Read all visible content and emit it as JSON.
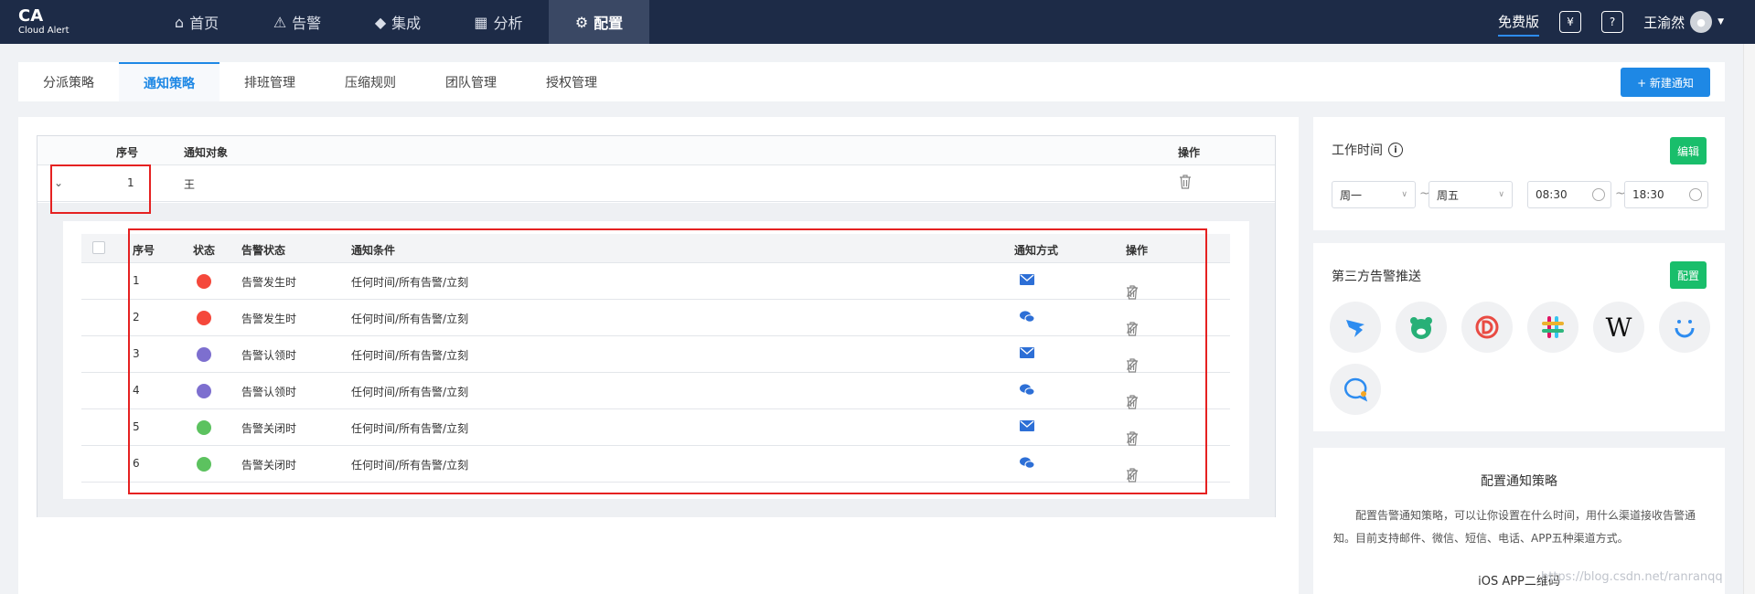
{
  "brand": {
    "name": "CA",
    "sub": "Cloud Alert"
  },
  "nav": [
    {
      "icon": "home-icon",
      "label": "首页",
      "active": false
    },
    {
      "icon": "alarm-icon",
      "label": "告警",
      "active": false
    },
    {
      "icon": "layers-icon",
      "label": "集成",
      "active": false
    },
    {
      "icon": "chart-icon",
      "label": "分析",
      "active": false
    },
    {
      "icon": "gear-icon",
      "label": "配置",
      "active": true
    }
  ],
  "header_right": {
    "plan": "免费版",
    "yen": "¥",
    "help": "?",
    "user": "王渝然"
  },
  "tabs": [
    "分派策略",
    "通知策略",
    "排班管理",
    "压缩规则",
    "团队管理",
    "授权管理"
  ],
  "active_tab": 1,
  "new_button": "+ 新建通知",
  "outer_table": {
    "headers": {
      "index": "序号",
      "target": "通知对象",
      "ops": "操作"
    },
    "row": {
      "index": "1",
      "target": "王"
    }
  },
  "inner_table": {
    "headers": {
      "index": "序号",
      "status": "状态",
      "alert_status": "告警状态",
      "condition": "通知条件",
      "via": "通知方式",
      "ops": "操作"
    },
    "rows": [
      {
        "index": "1",
        "color": "#f5483b",
        "alert_status": "告警发生时",
        "condition": "任何时间/所有告警/立刻",
        "via": "mail"
      },
      {
        "index": "2",
        "color": "#f5483b",
        "alert_status": "告警发生时",
        "condition": "任何时间/所有告警/立刻",
        "via": "wechat"
      },
      {
        "index": "3",
        "color": "#7d6fcf",
        "alert_status": "告警认领时",
        "condition": "任何时间/所有告警/立刻",
        "via": "mail"
      },
      {
        "index": "4",
        "color": "#7d6fcf",
        "alert_status": "告警认领时",
        "condition": "任何时间/所有告警/立刻",
        "via": "wechat"
      },
      {
        "index": "5",
        "color": "#5cc25f",
        "alert_status": "告警关闭时",
        "condition": "任何时间/所有告警/立刻",
        "via": "mail"
      },
      {
        "index": "6",
        "color": "#5cc25f",
        "alert_status": "告警关闭时",
        "condition": "任何时间/所有告警/立刻",
        "via": "wechat"
      }
    ]
  },
  "work_time": {
    "title": "工作时间",
    "edit": "编辑",
    "day_from": "周一",
    "day_to": "周五",
    "time_from": "08:30",
    "time_to": "18:30",
    "tilde": "~"
  },
  "third_party": {
    "title": "第三方告警推送",
    "config": "配置",
    "integrations": [
      "dingtalk-icon",
      "bear-icon",
      "circle-d-icon",
      "slack-icon",
      "w-icon",
      "smile-icon",
      "chat-icon"
    ]
  },
  "help": {
    "title": "配置通知策略",
    "text": "配置告警通知策略，可以让你设置在什么时间，用什么渠道接收告警通知。目前支持邮件、微信、短信、电话、APP五种渠道方式。",
    "ios": "iOS APP二维码"
  },
  "watermark": "https://blog.csdn.net/ranranqq"
}
